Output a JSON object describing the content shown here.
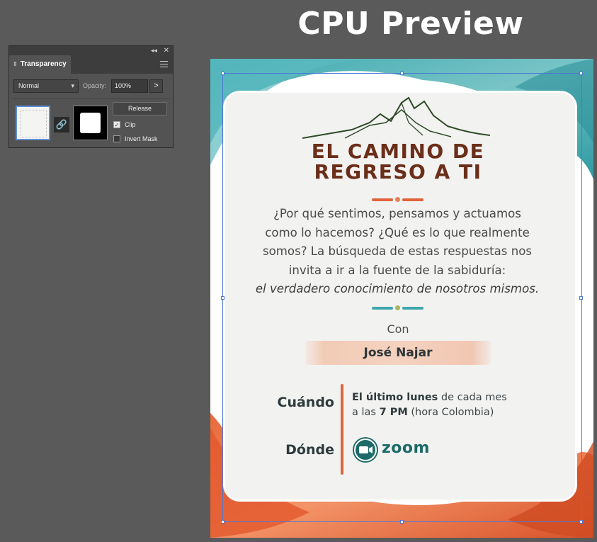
{
  "preview_title": "CPU Preview",
  "panel": {
    "collapse_icon": "double-chevron-left-icon",
    "close_icon": "close-icon",
    "tab_label": "Transparency",
    "blend_mode": "Normal",
    "opacity_label": "Opacity:",
    "opacity_value": "100%",
    "opacity_arrow": ">",
    "release_label": "Release",
    "clip_label": "Clip",
    "clip_checked": true,
    "invert_mask_label": "Invert Mask",
    "invert_mask_checked": false
  },
  "poster": {
    "title_line1": "EL CAMINO DE",
    "title_line2": "REGRESO A TI",
    "body_line1": "¿Por qué sentimos, pensamos y actuamos",
    "body_line2": "como lo hacemos? ¿Qué es lo que realmente",
    "body_line3": "somos? La búsqueda de estas respuestas nos",
    "body_line4": "invita a ir a la fuente de la sabiduría:",
    "body_emphasis": "el verdadero conocimiento de nosotros mismos.",
    "con_label": "Con",
    "speaker_name": "José Najar",
    "when_label": "Cuándo",
    "where_label": "Dónde",
    "when_bold": "El último lunes",
    "when_rest": " de cada mes",
    "when_line2_pre": "a las ",
    "when_time": "7 PM",
    "when_tz": " (hora Colombia)",
    "platform": "zoom",
    "colors": {
      "teal": "#3fa7ae",
      "orange": "#e0643a",
      "brown": "#6b2e18",
      "zoom_teal": "#1d6b69"
    }
  }
}
